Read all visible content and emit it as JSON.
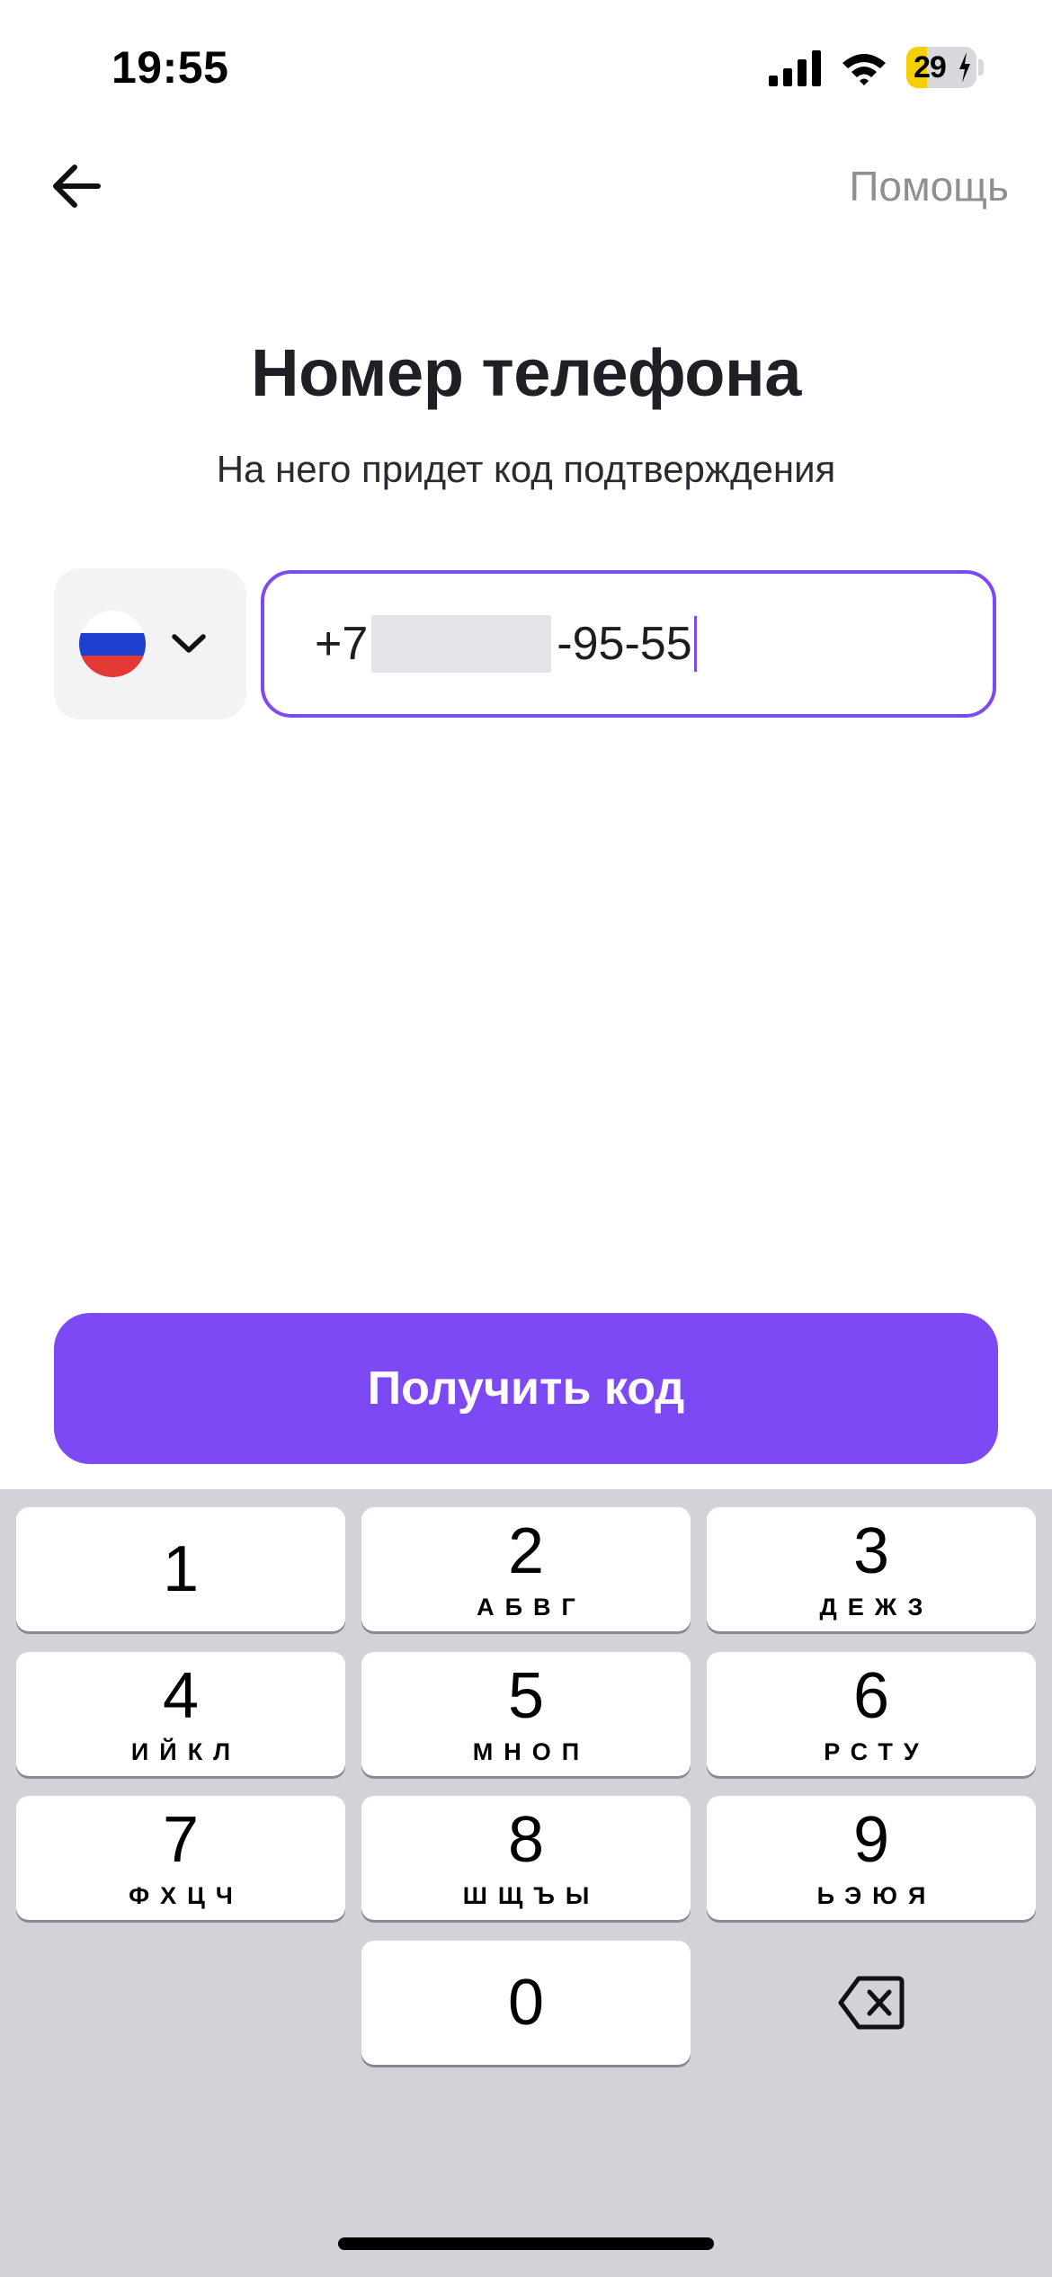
{
  "status_bar": {
    "time": "19:55",
    "battery_level": "29",
    "battery_fraction": 0.29,
    "icons": [
      "signal-icon",
      "wifi-icon",
      "battery-charging-icon"
    ]
  },
  "nav": {
    "back_icon": "arrow-left-icon",
    "help_label": "Помощь"
  },
  "header": {
    "title": "Номер телефона",
    "subtitle": "На него придет код подтверждения"
  },
  "country_selector": {
    "flag": "russia-flag-icon",
    "chevron": "chevron-down-icon",
    "flag_colors": [
      "#ffffff",
      "#1c3fd0",
      "#e53935"
    ]
  },
  "phone_input": {
    "prefix": "+7",
    "suffix": "-95-55",
    "masked": true
  },
  "cta": {
    "label": "Получить код",
    "color": "#7c49f5"
  },
  "keypad": {
    "keys": [
      {
        "digit": "1",
        "letters": ""
      },
      {
        "digit": "2",
        "letters": "АБВГ"
      },
      {
        "digit": "3",
        "letters": "ДЕЖЗ"
      },
      {
        "digit": "4",
        "letters": "ИЙКЛ"
      },
      {
        "digit": "5",
        "letters": "МНОП"
      },
      {
        "digit": "6",
        "letters": "РСТУ"
      },
      {
        "digit": "7",
        "letters": "ФХЦЧ"
      },
      {
        "digit": "8",
        "letters": "ШЩЪЫ"
      },
      {
        "digit": "9",
        "letters": "ЬЭЮЯ"
      },
      {
        "digit": "0",
        "letters": ""
      }
    ],
    "delete_icon": "backspace-icon"
  },
  "theme": {
    "accent": "#7c49f5",
    "keyboard_bg": "#d1d3d9",
    "help_text": "#8e8e95"
  }
}
